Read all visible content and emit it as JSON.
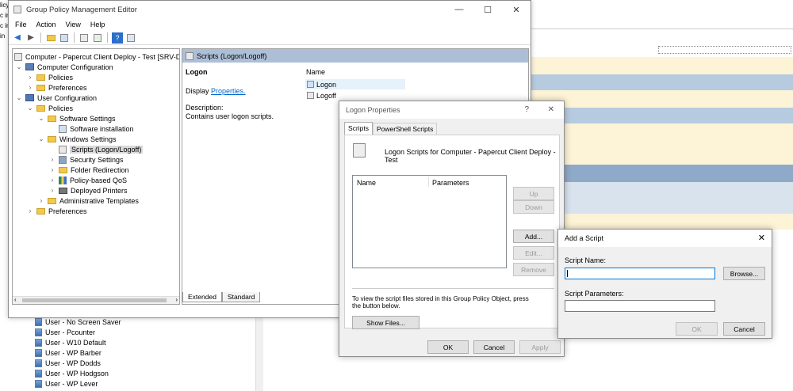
{
  "window": {
    "title": "Group Policy Management Editor",
    "min": "—",
    "max": "☐",
    "close": "✕"
  },
  "menu": [
    "File",
    "Action",
    "View",
    "Help"
  ],
  "tree": {
    "root": "Computer - Papercut Client Deploy - Test [SRV-DC2",
    "items": [
      {
        "label": "Computer Configuration"
      },
      {
        "label": "Policies"
      },
      {
        "label": "Preferences"
      },
      {
        "label": "User Configuration"
      },
      {
        "label": "Policies"
      },
      {
        "label": "Software Settings"
      },
      {
        "label": "Software installation"
      },
      {
        "label": "Windows Settings"
      },
      {
        "label": "Scripts (Logon/Logoff)"
      },
      {
        "label": "Security Settings"
      },
      {
        "label": "Folder Redirection"
      },
      {
        "label": "Policy-based QoS"
      },
      {
        "label": "Deployed Printers"
      },
      {
        "label": "Administrative Templates"
      },
      {
        "label": "Preferences"
      }
    ]
  },
  "pane": {
    "header": "Scripts (Logon/Logoff)",
    "heading": "Logon",
    "display_prefix": "Display",
    "display_link": "Properties.",
    "desc_label": "Description:",
    "desc_text": "Contains user logon scripts.",
    "col_name": "Name",
    "items": [
      "Logon",
      "Logoff"
    ],
    "tab_extended": "Extended",
    "tab_standard": "Standard"
  },
  "logon_dialog": {
    "title": "Logon Properties",
    "help": "?",
    "close": "✕",
    "tab_scripts": "Scripts",
    "tab_ps": "PowerShell Scripts",
    "caption": "Logon Scripts for Computer - Papercut Client Deploy - Test",
    "col_name": "Name",
    "col_params": "Parameters",
    "up": "Up",
    "down": "Down",
    "add": "Add...",
    "edit": "Edit...",
    "remove": "Remove",
    "info": "To view the script files stored in this Group Policy Object, press the button below.",
    "show_files": "Show Files...",
    "ok": "OK",
    "cancel": "Cancel",
    "apply": "Apply"
  },
  "add_dialog": {
    "title": "Add a Script",
    "close": "✕",
    "name_label": "Script Name:",
    "browse": "Browse...",
    "params_label": "Script Parameters:",
    "ok": "OK",
    "cancel": "Cancel"
  },
  "background": {
    "list": [
      "User - No Screen Saver",
      "User - Pcounter",
      "User - W10 Default",
      "User - WP Barber",
      "User - WP Dodds",
      "User - WP Hodgson",
      "User - WP Lever"
    ],
    "left_fragments": [
      "licy",
      "c ir",
      "c ir",
      "in"
    ],
    "bands": [
      "#fdf3d6",
      "#b7cbe0",
      "#fdf3d6",
      "#b7cbe0",
      "#fdf3d6",
      "#8fa9c9",
      "#d8e3ee",
      "#fdf3d6"
    ]
  }
}
